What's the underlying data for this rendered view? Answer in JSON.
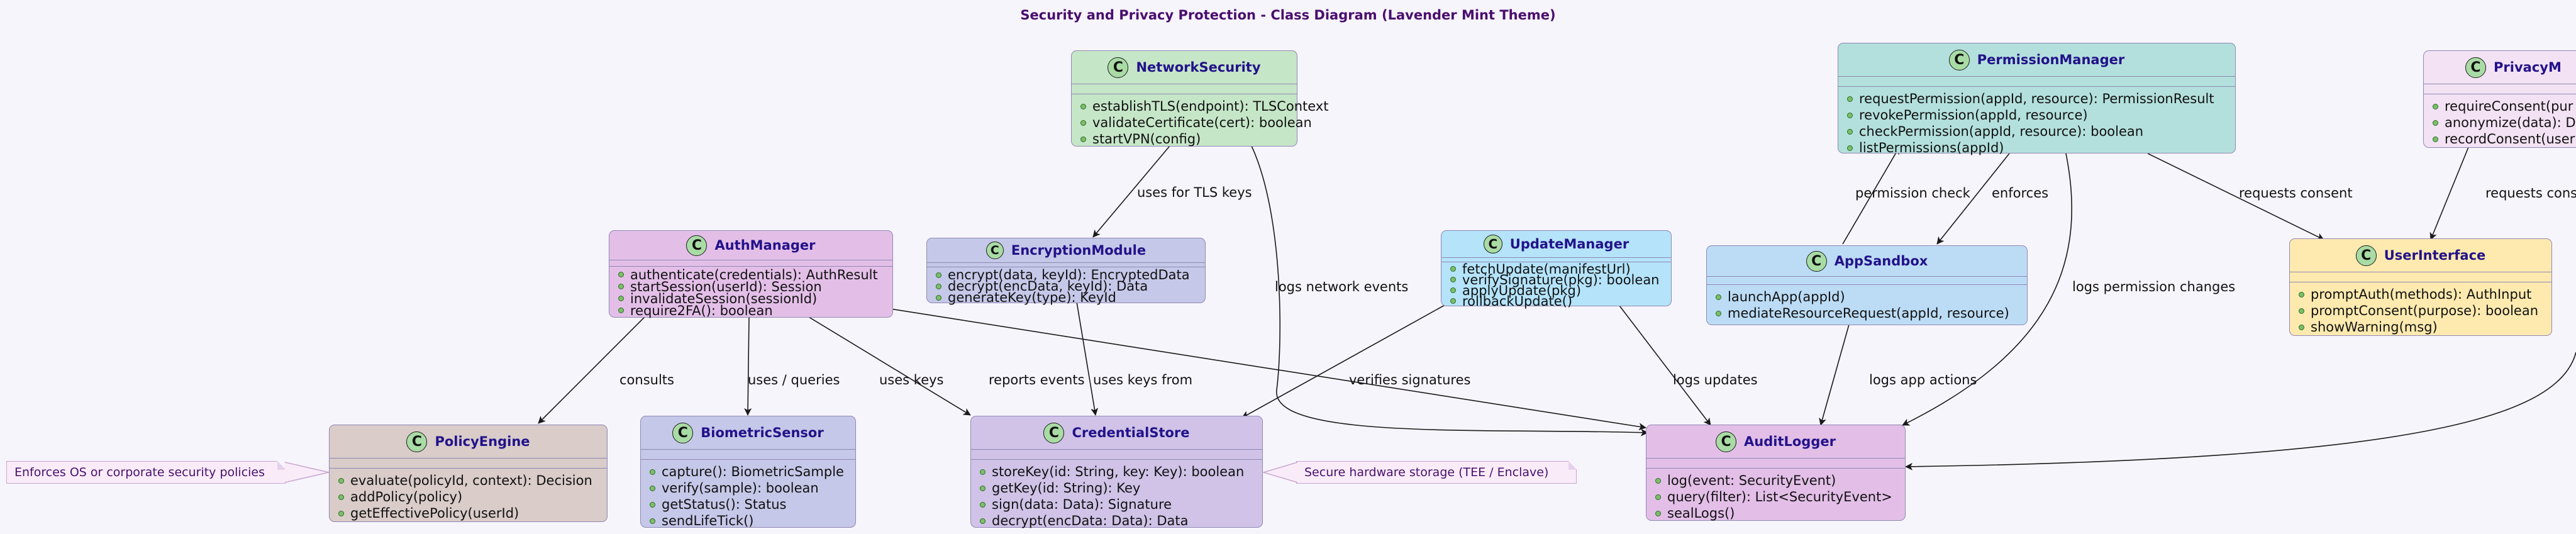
{
  "title": "Security and Privacy Protection - Class Diagram (Lavender Mint Theme)",
  "badge_letter": "C",
  "classes": {
    "networkSecurity": {
      "name": "NetworkSecurity",
      "color": "#c6e6c8",
      "methods": [
        "establishTLS(endpoint): TLSContext",
        "validateCertificate(cert): boolean",
        "startVPN(config)"
      ]
    },
    "permissionManager": {
      "name": "PermissionManager",
      "color": "#b3e0dc",
      "methods": [
        "requestPermission(appId, resource): PermissionResult",
        "revokePermission(appId, resource)",
        "checkPermission(appId, resource): boolean",
        "listPermissions(appId)"
      ]
    },
    "privacyManager": {
      "name": "PrivacyM",
      "color": "#f3e2f3",
      "methods": [
        "requireConsent(pur",
        "anonymize(data): D",
        "recordConsent(user"
      ]
    },
    "authManager": {
      "name": "AuthManager",
      "color": "#e3bfe8",
      "methods": [
        "authenticate(credentials): AuthResult",
        "startSession(userId): Session",
        "invalidateSession(sessionId)",
        "require2FA(): boolean"
      ]
    },
    "encryptionModule": {
      "name": "EncryptionModule",
      "color": "#c5c8e8",
      "methods": [
        "encrypt(data, keyId): EncryptedData",
        "decrypt(encData, keyId): Data",
        "generateKey(type): KeyId"
      ]
    },
    "updateManager": {
      "name": "UpdateManager",
      "color": "#b4e3fa",
      "methods": [
        "fetchUpdate(manifestUrl)",
        "verifySignature(pkg): boolean",
        "applyUpdate(pkg)",
        "rollbackUpdate()"
      ]
    },
    "appSandbox": {
      "name": "AppSandbox",
      "color": "#bcdcf6",
      "methods": [
        "launchApp(appId)",
        "mediateResourceRequest(appId, resource)"
      ]
    },
    "userInterface": {
      "name": "UserInterface",
      "color": "#feeaaf",
      "methods": [
        "promptAuth(methods): AuthInput",
        "promptConsent(purpose): boolean",
        "showWarning(msg)"
      ]
    },
    "policyEngine": {
      "name": "PolicyEngine",
      "color": "#d9ccc9",
      "methods": [
        "evaluate(policyId, context): Decision",
        "addPolicy(policy)",
        "getEffectivePolicy(userId)"
      ]
    },
    "biometricSensor": {
      "name": "BiometricSensor",
      "color": "#c5c8e8",
      "methods": [
        "capture(): BiometricSample",
        "verify(sample): boolean",
        "getStatus(): Status",
        "sendLifeTick()"
      ]
    },
    "credentialStore": {
      "name": "CredentialStore",
      "color": "#d0c3e7",
      "methods": [
        "storeKey(id: String, key: Key): boolean",
        "getKey(id: String): Key",
        "sign(data: Data): Signature",
        "decrypt(encData: Data): Data"
      ]
    },
    "auditLogger": {
      "name": "AuditLogger",
      "color": "#e3bfe8",
      "methods": [
        "log(event: SecurityEvent)",
        "query(filter): List<SecurityEvent>",
        "sealLogs()"
      ]
    }
  },
  "notes": {
    "policy": "Enforces OS or corporate security policies",
    "credential": "Secure hardware storage (TEE / Enclave)"
  },
  "relations": {
    "uses_tls_keys": "uses for TLS keys",
    "logs_network": "logs network events",
    "permission_check": "permission check",
    "enforces": "enforces",
    "logs_permission": "logs permission changes",
    "requests_consent": "requests consent",
    "requests_consent_2": "requests conse",
    "consults": "consults",
    "uses_queries": "uses / queries",
    "uses_keys": "uses keys",
    "reports_events": "reports events",
    "uses_keys_from": "uses keys from",
    "verifies_signatures": "verifies signatures",
    "logs_updates": "logs updates",
    "logs_app_actions": "logs app actions"
  }
}
